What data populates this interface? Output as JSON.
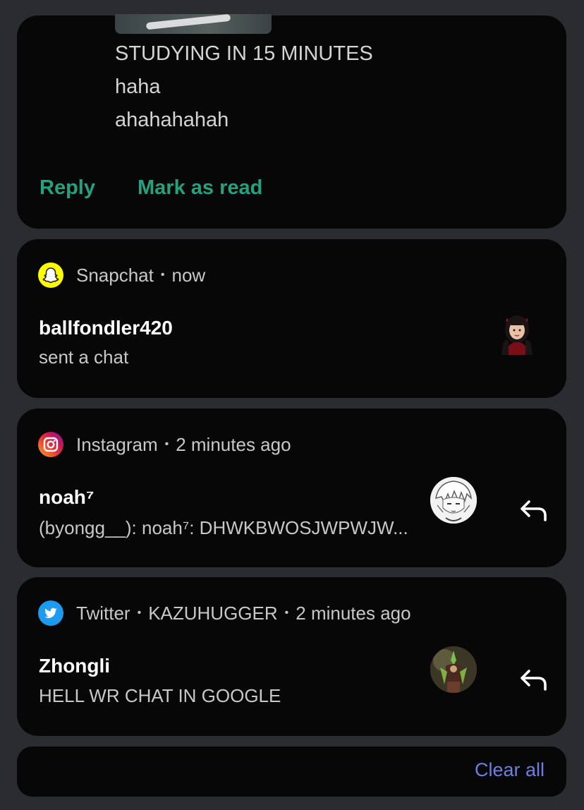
{
  "message_card": {
    "lines": [
      "STUDYING IN 15 MINUTES",
      "haha",
      "ahahahahah"
    ],
    "actions": {
      "reply_label": "Reply",
      "mark_read_label": "Mark as read"
    },
    "accent_color": "#26a17d"
  },
  "notifications": [
    {
      "app": "Snapchat",
      "separator": "•",
      "time": "now",
      "sender": "ballfondler420",
      "body": "sent a chat",
      "icon": "snapchat-icon",
      "avatar": "bitmoji-avatar",
      "has_reply": false
    },
    {
      "app": "Instagram",
      "separator": "•",
      "time": "2 minutes ago",
      "sender": "noah⁷",
      "body": "(byongg__): noah⁷: DHWKBWOSJWPWJW...",
      "icon": "instagram-icon",
      "avatar": "anime-avatar",
      "has_reply": true
    },
    {
      "app": "Twitter",
      "separator": "•",
      "account": "KAZUHUGGER",
      "time": "2 minutes ago",
      "sender": "Zhongli",
      "body": "HELL WR CHAT IN GOOGLE",
      "icon": "twitter-icon",
      "avatar": "game-character-avatar",
      "has_reply": true
    }
  ],
  "footer": {
    "clear_all_label": "Clear all",
    "clear_all_color": "#6f7fe0"
  }
}
